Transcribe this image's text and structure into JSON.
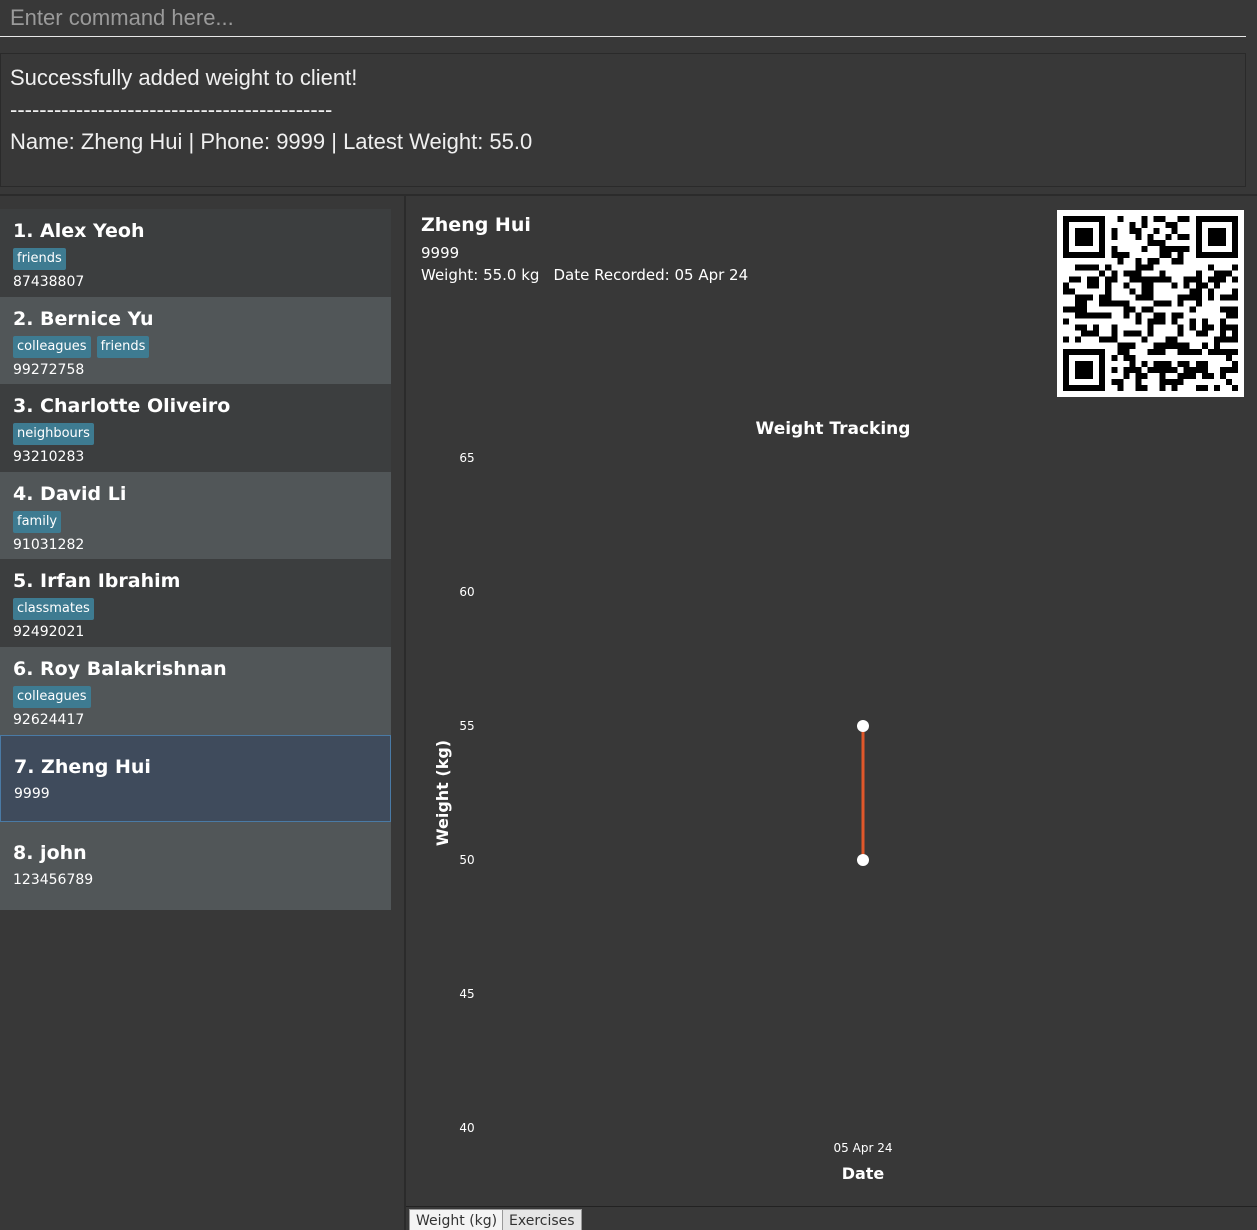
{
  "command": {
    "placeholder": "Enter command here..."
  },
  "result": {
    "line1": "Successfully added weight to client!",
    "line2": "--------------------------------------------",
    "line3": "Name: Zheng Hui | Phone: 9999 | Latest Weight: 55.0"
  },
  "clients": [
    {
      "name": "1. Alex Yeoh",
      "tags": [
        "friends"
      ],
      "phone": "87438807"
    },
    {
      "name": "2. Bernice Yu",
      "tags": [
        "colleagues",
        "friends"
      ],
      "phone": "99272758"
    },
    {
      "name": "3. Charlotte Oliveiro",
      "tags": [
        "neighbours"
      ],
      "phone": "93210283"
    },
    {
      "name": "4. David Li",
      "tags": [
        "family"
      ],
      "phone": "91031282"
    },
    {
      "name": "5. Irfan Ibrahim",
      "tags": [
        "classmates"
      ],
      "phone": "92492021"
    },
    {
      "name": "6. Roy Balakrishnan",
      "tags": [
        "colleagues"
      ],
      "phone": "92624417"
    },
    {
      "name": "7. Zheng Hui",
      "tags": [],
      "phone": "9999"
    },
    {
      "name": "8. john",
      "tags": [],
      "phone": "123456789"
    }
  ],
  "selected_index": 6,
  "detail": {
    "name": "Zheng Hui",
    "phone": "9999",
    "weight": "Weight: 55.0 kg",
    "date_recorded": "Date Recorded: 05 Apr 24"
  },
  "chart_data": {
    "type": "line",
    "title": "Weight Tracking",
    "xlabel": "Date",
    "ylabel": "Weight (kg)",
    "ylim": [
      40,
      65
    ],
    "yticks": [
      40,
      45,
      50,
      55,
      60,
      65
    ],
    "categories": [
      "05 Apr 24"
    ],
    "series": [
      {
        "x": [
          "05 Apr 24",
          "05 Apr 24"
        ],
        "values": [
          50,
          55
        ]
      }
    ],
    "line_color": "#e0572a",
    "grid": false,
    "legend": "none"
  },
  "tabs": [
    {
      "label": "Weight (kg)",
      "active": true
    },
    {
      "label": "Exercises",
      "active": false
    }
  ],
  "colors": {
    "tag": "#3e7b91",
    "selected_card": "#3f4b5c",
    "accent_line": "#e0572a"
  }
}
